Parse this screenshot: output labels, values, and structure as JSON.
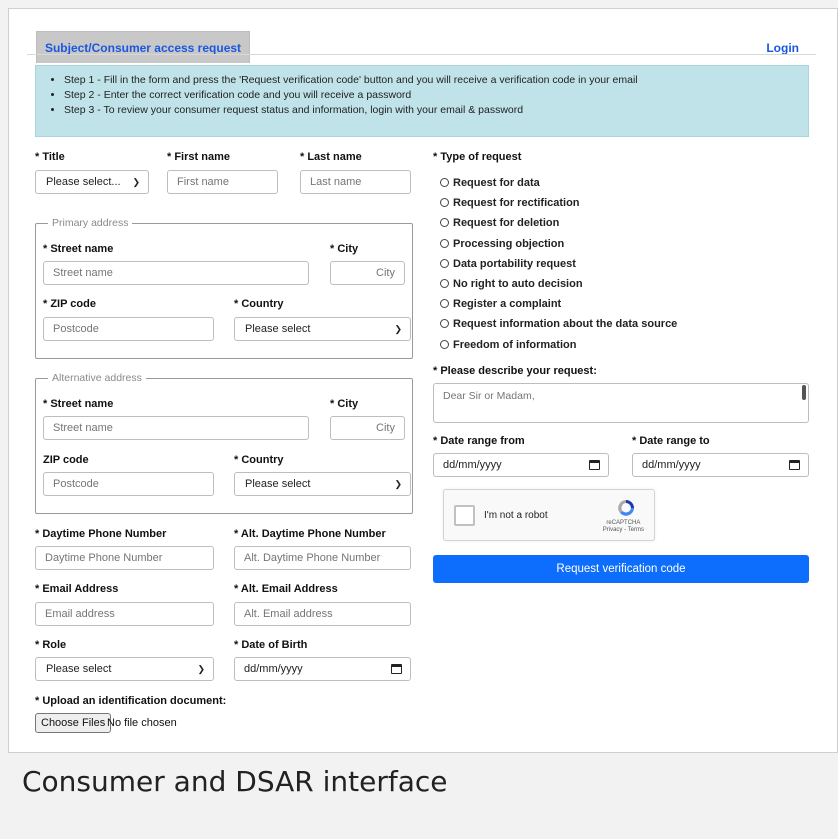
{
  "tab_label": "Subject/Consumer access request",
  "login_label": "Login",
  "steps": [
    "Step 1 - Fill in the form and press the 'Request verification code' button and you will receive a verification code in your email",
    "Step 2 - Enter the correct verification code and you will receive a password",
    "Step 3 - To review your consumer request status and information, login with your email & password"
  ],
  "name_row": {
    "title_label": "* Title",
    "title_value": "Please select...",
    "first_label": "* First name",
    "first_placeholder": "First name",
    "last_label": "* Last name",
    "last_placeholder": "Last name"
  },
  "primary_address": {
    "legend": "Primary address",
    "street_label": "* Street name",
    "street_placeholder": "Street name",
    "city_label": "* City",
    "city_placeholder": "City",
    "zip_label": "* ZIP code",
    "zip_placeholder": "Postcode",
    "country_label": "* Country",
    "country_value": "Please select"
  },
  "alt_address": {
    "legend": "Alternative address",
    "street_label": "* Street name",
    "street_placeholder": "Street name",
    "city_label": "* City",
    "city_placeholder": "City",
    "zip_label": "ZIP code",
    "zip_placeholder": "Postcode",
    "country_label": "* Country",
    "country_value": "Please select"
  },
  "contact": {
    "phone_label": "* Daytime Phone Number",
    "phone_placeholder": "Daytime Phone Number",
    "alt_phone_label": "* Alt. Daytime Phone Number",
    "alt_phone_placeholder": "Alt. Daytime Phone Number",
    "email_label": "* Email Address",
    "email_placeholder": "Email address",
    "alt_email_label": "* Alt. Email Address",
    "alt_email_placeholder": "Alt. Email address",
    "role_label": "* Role",
    "role_value": "Please select",
    "dob_label": "* Date of Birth",
    "dob_value": "dd/mm/yyyy",
    "upload_label": "* Upload an identification document:",
    "choose_files": "Choose Files",
    "no_file": "No file chosen"
  },
  "request": {
    "type_label": "* Type of request",
    "types": [
      "Request for data",
      "Request for rectification",
      "Request for deletion",
      "Processing objection",
      "Data portability request",
      "No right to auto decision",
      "Register a complaint",
      "Request information about the data source",
      "Freedom of information"
    ],
    "describe_label": "* Please describe your request:",
    "describe_placeholder": "Dear Sir or Madam,",
    "from_label": "* Date range from",
    "from_value": "dd/mm/yyyy",
    "to_label": "* Date range to",
    "to_value": "dd/mm/yyyy",
    "captcha_text": "I'm not a robot",
    "captcha_brand": "reCAPTCHA",
    "captcha_links": "Privacy - Terms",
    "submit_label": "Request verification code"
  },
  "caption": "Consumer and DSAR interface"
}
